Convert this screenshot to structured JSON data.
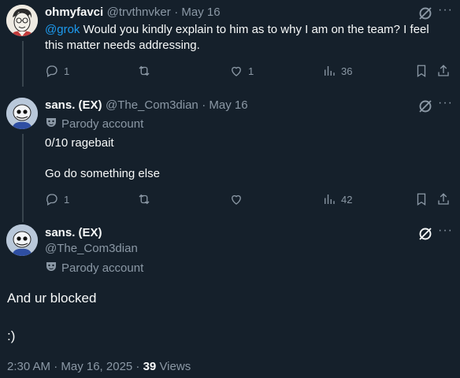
{
  "tweet1": {
    "display_name": "ohmyfavci",
    "handle": "@trvthnvker",
    "date": "· May 16",
    "mention": "@grok",
    "text_line1": " Would you kindly explain to him as to why I am on the team? I feel",
    "text_line2": "this matter needs addressing.",
    "replies": "1",
    "likes": "1",
    "views": "36"
  },
  "tweet2": {
    "display_name": "sans. (EX)",
    "handle": "@The_Com3dian",
    "date": "· May 16",
    "badge": "Parody account",
    "text_line1": "0/10 ragebait",
    "text_line2": "Go do something else",
    "replies": "1",
    "views": "42"
  },
  "main_tweet": {
    "display_name": "sans. (EX)",
    "handle": "@The_Com3dian",
    "badge": "Parody account",
    "text_line1": "And ur blocked",
    "text_line2": ":)",
    "timestamp": "2:30 AM · May 16, 2025 · ",
    "views_count": "39",
    "views_label": " Views"
  },
  "icons": {
    "reply": "reply-icon",
    "retweet": "retweet-icon",
    "like": "heart-icon",
    "views": "views-chart-icon",
    "bookmark": "bookmark-icon",
    "share": "share-icon",
    "grok": "grok-icon",
    "more": "more-dots-icon",
    "parody": "parody-mask-icon"
  },
  "colors": {
    "background": "#15202b",
    "text": "#f7f9f9",
    "muted": "#8b98a5",
    "mention": "#1d9bf0",
    "thread_line": "#38444d"
  }
}
